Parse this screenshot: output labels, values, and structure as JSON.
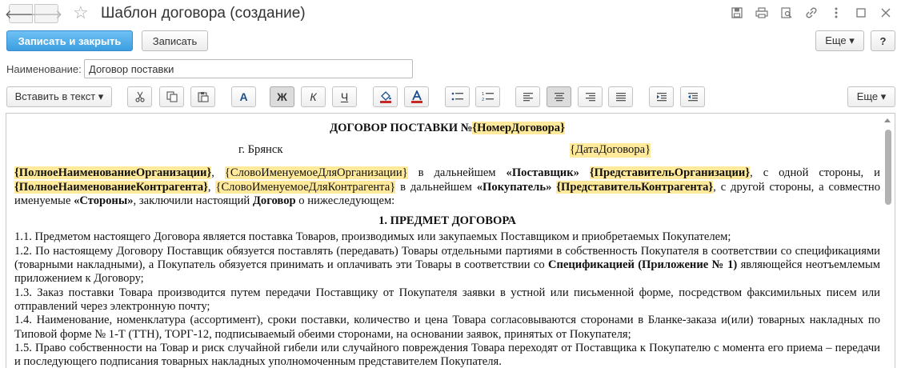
{
  "window": {
    "title": "Шаблон договора (создание)",
    "nav_back": "🡐",
    "nav_forward": "🡒",
    "icons": [
      "save-icon",
      "print-icon",
      "preview-icon",
      "link-icon",
      "more-vertical-icon",
      "maximize-icon",
      "close-icon"
    ]
  },
  "commands": {
    "write_close": "Записать и закрыть",
    "write": "Записать",
    "more": "Еще ▾",
    "help": "?"
  },
  "name_field": {
    "label": "Наименование:",
    "value": "Договор поставки"
  },
  "format_toolbar": {
    "insert_text": "Вставить в текст ▾",
    "bold": "Ж",
    "italic": "К",
    "underline": "Ч",
    "font": "A",
    "more": "Еще ▾",
    "colors": {
      "accent": "#3b9ee0",
      "highlight": "#ffe99a",
      "font_color_bar": "#c62828",
      "fill_bar": "#c62828"
    }
  },
  "document": {
    "heading_prefix": "ДОГОВОР ПОСТАВКИ №",
    "heading_field": "{НомерДоговора}",
    "city": "г. Брянск",
    "date_field": "{ДатаДоговора}",
    "intro": {
      "org_full": "{ПолноеНаименованиеОрганизации}",
      "org_named": "{СловоИменуемоеДляОрганизации}",
      "t1": " в дальнейшем ",
      "supplier": "«Поставщик»",
      "org_rep": "{ПредставительОрганизации}",
      "t2": ", с одной стороны, и ",
      "contr_full": "{ПолноеНаименованиеКонтрагента}",
      "contr_named": "{СловоИменуемоеДляКонтрагента}",
      "t3": " в дальнейшем ",
      "buyer": "«Покупатель»",
      "contr_rep": "{ПредставительКонтрагента}",
      "t4": ", с другой стороны, а совместно именуемые ",
      "parties": "«Стороны»",
      "t5": ", заключили настоящий ",
      "contract": "Договор",
      "t6": " о нижеследующем:"
    },
    "section1_title": "1. ПРЕДМЕТ ДОГОВОРА",
    "p1_1": "1.1. Предметом настоящего Договора является поставка Товаров, производимых или закупаемых Поставщиком и приобретаемых Покупателем;",
    "p1_2a": "1.2. По настоящему Договору Поставщик обязуется поставлять (передавать) Товары отдельными партиями в собственность Покупателя в соответствии со спецификациями (товарными накладными), а Покупатель обязуется принимать и оплачивать эти Товары в соответствии со ",
    "p1_2b": "Спецификацией (Приложение № 1)",
    "p1_2c": " являющейся неотъемлемым приложением к Договору;",
    "p1_3": "1.3. Заказ поставки Товара производится путем передачи Поставщику от Покупателя заявки в устной или письменной форме, посредством факсимильных писем или отправлений через электронную почту;",
    "p1_4": "1.4. Наименование, номенклатура (ассортимент), сроки поставки, количество и цена Товара согласовываются сторонами в Бланке-заказа и(или) товарных накладных по Типовой форме № 1-Т (ТТН), ТОРГ-12, подписываемый обеими сторонами, на основании заявок, принятых от Покупателя;",
    "p1_5": "1.5. Право собственности на Товар и риск случайной гибели или случайного повреждения Товара переходят от Поставщика к Покупателю с момента его приема – передачи и последующего подписания товарных накладных уполномоченным представителем Покупателя."
  }
}
